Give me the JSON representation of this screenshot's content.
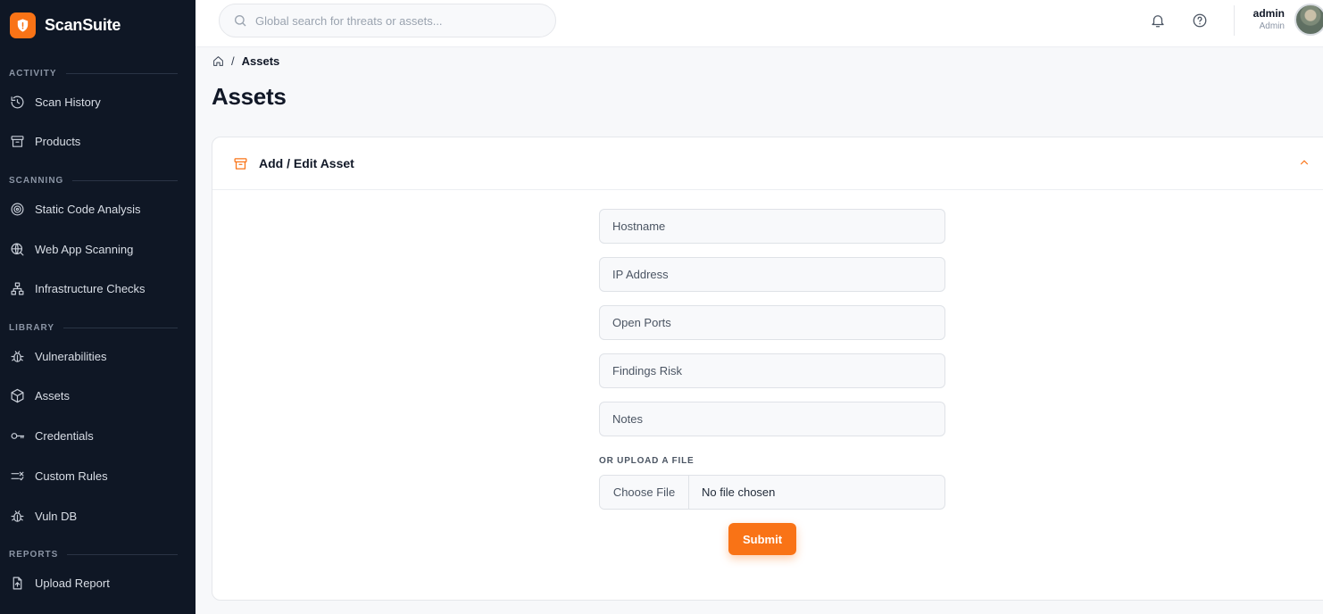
{
  "brand": {
    "name": "ScanSuite",
    "accent": "#f97316",
    "icon": "shield-icon"
  },
  "sidebar": {
    "sections": [
      {
        "label": "ACTIVITY"
      },
      {
        "label": "SCANNING"
      },
      {
        "label": "LIBRARY"
      },
      {
        "label": "REPORTS"
      }
    ],
    "items": [
      {
        "label": "Scan History",
        "icon": "history-icon"
      },
      {
        "label": "Products",
        "icon": "archive-icon"
      },
      {
        "label": "Static Code Analysis",
        "icon": "target-icon"
      },
      {
        "label": "Web App Scanning",
        "icon": "globe-search-icon"
      },
      {
        "label": "Infrastructure Checks",
        "icon": "network-icon"
      },
      {
        "label": "Vulnerabilities",
        "icon": "bug-icon"
      },
      {
        "label": "Assets",
        "icon": "cube-icon"
      },
      {
        "label": "Credentials",
        "icon": "key-icon"
      },
      {
        "label": "Custom Rules",
        "icon": "list-check-icon"
      },
      {
        "label": "Vuln DB",
        "icon": "bug-icon"
      },
      {
        "label": "Upload Report",
        "icon": "file-upload-icon"
      }
    ]
  },
  "topbar": {
    "search_placeholder": "Global search for threats or assets...",
    "user": {
      "name": "admin",
      "role": "Admin"
    }
  },
  "breadcrumb": {
    "separator": "/",
    "current": "Assets"
  },
  "page": {
    "title": "Assets"
  },
  "form": {
    "title": "Add / Edit Asset",
    "fields": [
      {
        "placeholder": "Hostname",
        "value": ""
      },
      {
        "placeholder": "IP Address",
        "value": ""
      },
      {
        "placeholder": "Open Ports",
        "value": ""
      },
      {
        "placeholder": "Findings Risk",
        "value": ""
      },
      {
        "placeholder": "Notes",
        "value": ""
      }
    ],
    "upload_label": "OR UPLOAD A FILE",
    "choose_file": "Choose File",
    "file_status": "No file chosen",
    "submit_label": "Submit"
  }
}
